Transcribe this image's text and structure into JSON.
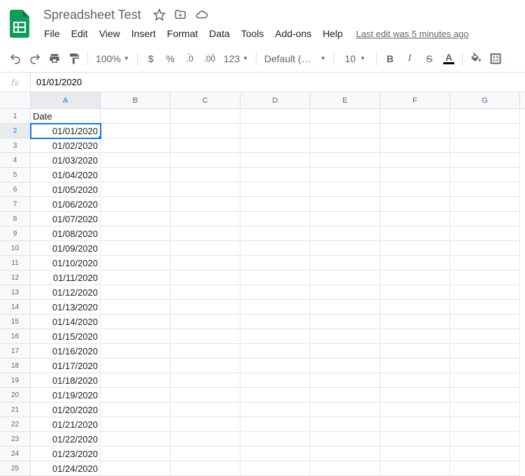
{
  "header": {
    "doc_title": "Spreadsheet Test",
    "last_edit": "Last edit was 5 minutes ago"
  },
  "menus": [
    "File",
    "Edit",
    "View",
    "Insert",
    "Format",
    "Data",
    "Tools",
    "Add-ons",
    "Help"
  ],
  "toolbar": {
    "zoom": "100%",
    "currency": "$",
    "percent": "%",
    "dec_dec": ".0",
    "inc_dec": ".00",
    "more_formats": "123",
    "font": "Default (Ari...",
    "font_size": "10",
    "bold": "B",
    "italic": "I",
    "strike": "S",
    "text_color": "A"
  },
  "formula_bar": {
    "fx": "fx",
    "value": "01/01/2020"
  },
  "columns": [
    "A",
    "B",
    "C",
    "D",
    "E",
    "F",
    "G"
  ],
  "selected_cell": {
    "row": 2,
    "col": 0
  },
  "rows": [
    {
      "num": 1,
      "cells": [
        "Date",
        "",
        "",
        "",
        "",
        "",
        ""
      ],
      "align": [
        "left",
        "left",
        "left",
        "left",
        "left",
        "left",
        "left"
      ]
    },
    {
      "num": 2,
      "cells": [
        "01/01/2020",
        "",
        "",
        "",
        "",
        "",
        ""
      ],
      "align": [
        "right",
        "left",
        "left",
        "left",
        "left",
        "left",
        "left"
      ]
    },
    {
      "num": 3,
      "cells": [
        "01/02/2020",
        "",
        "",
        "",
        "",
        "",
        ""
      ],
      "align": [
        "right",
        "left",
        "left",
        "left",
        "left",
        "left",
        "left"
      ]
    },
    {
      "num": 4,
      "cells": [
        "01/03/2020",
        "",
        "",
        "",
        "",
        "",
        ""
      ],
      "align": [
        "right",
        "left",
        "left",
        "left",
        "left",
        "left",
        "left"
      ]
    },
    {
      "num": 5,
      "cells": [
        "01/04/2020",
        "",
        "",
        "",
        "",
        "",
        ""
      ],
      "align": [
        "right",
        "left",
        "left",
        "left",
        "left",
        "left",
        "left"
      ]
    },
    {
      "num": 6,
      "cells": [
        "01/05/2020",
        "",
        "",
        "",
        "",
        "",
        ""
      ],
      "align": [
        "right",
        "left",
        "left",
        "left",
        "left",
        "left",
        "left"
      ]
    },
    {
      "num": 7,
      "cells": [
        "01/06/2020",
        "",
        "",
        "",
        "",
        "",
        ""
      ],
      "align": [
        "right",
        "left",
        "left",
        "left",
        "left",
        "left",
        "left"
      ]
    },
    {
      "num": 8,
      "cells": [
        "01/07/2020",
        "",
        "",
        "",
        "",
        "",
        ""
      ],
      "align": [
        "right",
        "left",
        "left",
        "left",
        "left",
        "left",
        "left"
      ]
    },
    {
      "num": 9,
      "cells": [
        "01/08/2020",
        "",
        "",
        "",
        "",
        "",
        ""
      ],
      "align": [
        "right",
        "left",
        "left",
        "left",
        "left",
        "left",
        "left"
      ]
    },
    {
      "num": 10,
      "cells": [
        "01/09/2020",
        "",
        "",
        "",
        "",
        "",
        ""
      ],
      "align": [
        "right",
        "left",
        "left",
        "left",
        "left",
        "left",
        "left"
      ]
    },
    {
      "num": 11,
      "cells": [
        "01/10/2020",
        "",
        "",
        "",
        "",
        "",
        ""
      ],
      "align": [
        "right",
        "left",
        "left",
        "left",
        "left",
        "left",
        "left"
      ]
    },
    {
      "num": 12,
      "cells": [
        "01/11/2020",
        "",
        "",
        "",
        "",
        "",
        ""
      ],
      "align": [
        "right",
        "left",
        "left",
        "left",
        "left",
        "left",
        "left"
      ]
    },
    {
      "num": 13,
      "cells": [
        "01/12/2020",
        "",
        "",
        "",
        "",
        "",
        ""
      ],
      "align": [
        "right",
        "left",
        "left",
        "left",
        "left",
        "left",
        "left"
      ]
    },
    {
      "num": 14,
      "cells": [
        "01/13/2020",
        "",
        "",
        "",
        "",
        "",
        ""
      ],
      "align": [
        "right",
        "left",
        "left",
        "left",
        "left",
        "left",
        "left"
      ]
    },
    {
      "num": 15,
      "cells": [
        "01/14/2020",
        "",
        "",
        "",
        "",
        "",
        ""
      ],
      "align": [
        "right",
        "left",
        "left",
        "left",
        "left",
        "left",
        "left"
      ]
    },
    {
      "num": 16,
      "cells": [
        "01/15/2020",
        "",
        "",
        "",
        "",
        "",
        ""
      ],
      "align": [
        "right",
        "left",
        "left",
        "left",
        "left",
        "left",
        "left"
      ]
    },
    {
      "num": 17,
      "cells": [
        "01/16/2020",
        "",
        "",
        "",
        "",
        "",
        ""
      ],
      "align": [
        "right",
        "left",
        "left",
        "left",
        "left",
        "left",
        "left"
      ]
    },
    {
      "num": 18,
      "cells": [
        "01/17/2020",
        "",
        "",
        "",
        "",
        "",
        ""
      ],
      "align": [
        "right",
        "left",
        "left",
        "left",
        "left",
        "left",
        "left"
      ]
    },
    {
      "num": 19,
      "cells": [
        "01/18/2020",
        "",
        "",
        "",
        "",
        "",
        ""
      ],
      "align": [
        "right",
        "left",
        "left",
        "left",
        "left",
        "left",
        "left"
      ]
    },
    {
      "num": 20,
      "cells": [
        "01/19/2020",
        "",
        "",
        "",
        "",
        "",
        ""
      ],
      "align": [
        "right",
        "left",
        "left",
        "left",
        "left",
        "left",
        "left"
      ]
    },
    {
      "num": 21,
      "cells": [
        "01/20/2020",
        "",
        "",
        "",
        "",
        "",
        ""
      ],
      "align": [
        "right",
        "left",
        "left",
        "left",
        "left",
        "left",
        "left"
      ]
    },
    {
      "num": 22,
      "cells": [
        "01/21/2020",
        "",
        "",
        "",
        "",
        "",
        ""
      ],
      "align": [
        "right",
        "left",
        "left",
        "left",
        "left",
        "left",
        "left"
      ]
    },
    {
      "num": 23,
      "cells": [
        "01/22/2020",
        "",
        "",
        "",
        "",
        "",
        ""
      ],
      "align": [
        "right",
        "left",
        "left",
        "left",
        "left",
        "left",
        "left"
      ]
    },
    {
      "num": 24,
      "cells": [
        "01/23/2020",
        "",
        "",
        "",
        "",
        "",
        ""
      ],
      "align": [
        "right",
        "left",
        "left",
        "left",
        "left",
        "left",
        "left"
      ]
    },
    {
      "num": 25,
      "cells": [
        "01/24/2020",
        "",
        "",
        "",
        "",
        "",
        ""
      ],
      "align": [
        "right",
        "left",
        "left",
        "left",
        "left",
        "left",
        "left"
      ]
    }
  ]
}
